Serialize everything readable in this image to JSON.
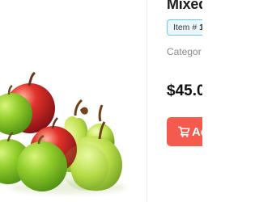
{
  "product": {
    "title": "Mixed",
    "item_badge": {
      "label": "Item #",
      "value": "1"
    },
    "category_label": "Categor",
    "price": "$45.0",
    "add_button_label": "Ad",
    "image_subject": "green apples, red apples and green pears"
  },
  "colors": {
    "button": "#f55a4e",
    "badge_border": "#6ec6ea",
    "badge_background": "#eaf7fc",
    "title": "#1d1d1d",
    "category": "#8a8a8a"
  },
  "icons": {
    "cart": "shopping-cart-icon"
  }
}
